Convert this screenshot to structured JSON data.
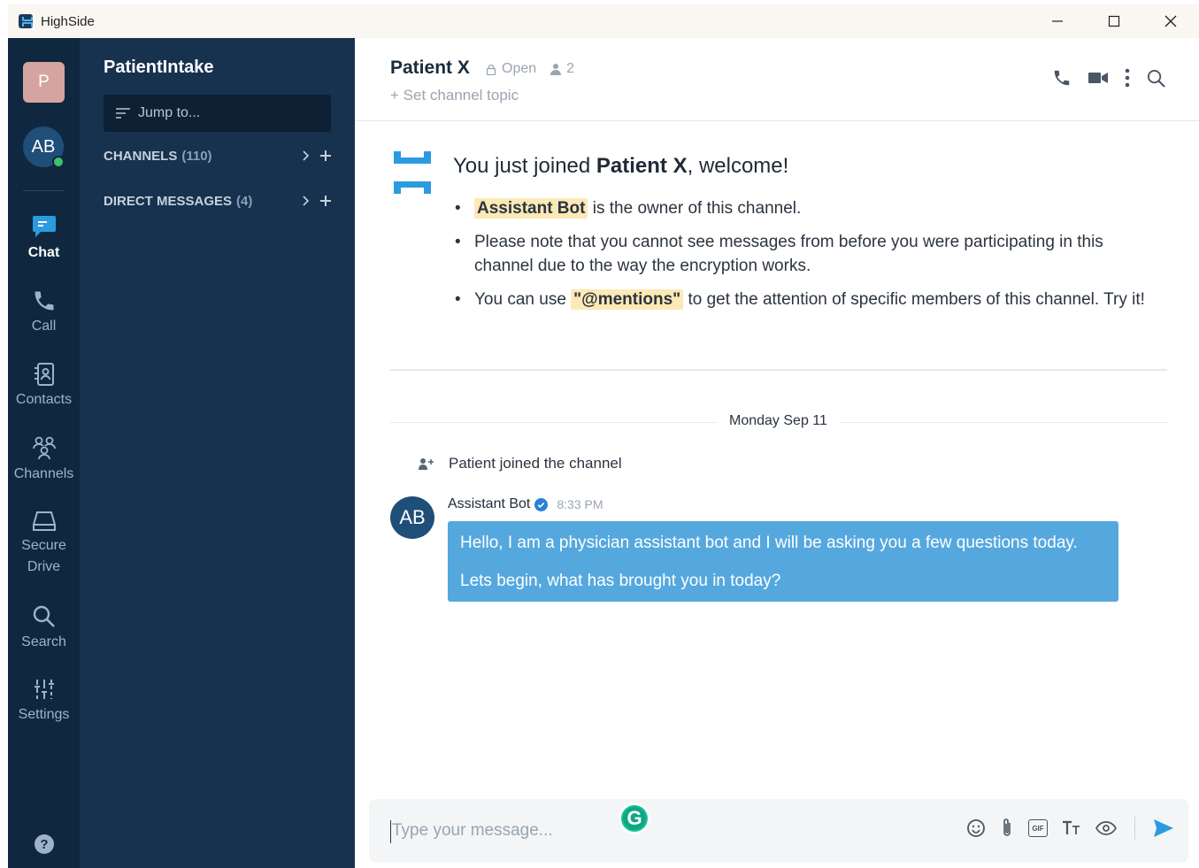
{
  "window": {
    "title": "HighSide"
  },
  "rail": {
    "workspace_initial": "P",
    "user_initials": "AB",
    "items": [
      {
        "label": "Chat",
        "icon": "chat-icon"
      },
      {
        "label": "Call",
        "icon": "phone-icon"
      },
      {
        "label": "Contacts",
        "icon": "contacts-icon"
      },
      {
        "label": "Channels",
        "icon": "channels-icon"
      },
      {
        "label": "Secure",
        "label2": "Drive",
        "icon": "drive-icon"
      },
      {
        "label": "Search",
        "icon": "search-icon"
      },
      {
        "label": "Settings",
        "icon": "settings-icon"
      }
    ],
    "help": "?"
  },
  "sidebar": {
    "workspace_name": "PatientIntake",
    "jump_placeholder": "Jump to...",
    "channels_label": "CHANNELS",
    "channels_count": "(110)",
    "dm_label": "DIRECT MESSAGES",
    "dm_count": "(4)"
  },
  "channel": {
    "name": "Patient X",
    "status": "Open",
    "members": "2",
    "topic_prompt": "+ Set channel topic"
  },
  "welcome": {
    "prefix": "You just joined ",
    "channel": "Patient X",
    "suffix": ", welcome!",
    "b1_owner": "Assistant Bot",
    "b1_text": " is the owner of this channel.",
    "b2_text": "Please note that you cannot see messages from before you were participating in this channel due to the way the encryption works.",
    "b3_pre": "You can use ",
    "b3_mentions": "\"@mentions\"",
    "b3_post": " to get the attention of specific members of this channel. Try it!"
  },
  "timeline": {
    "date": "Monday Sep 11",
    "system_message": "Patient joined the channel",
    "message": {
      "avatar": "AB",
      "author": "Assistant Bot",
      "time": "8:33 PM",
      "line1": "Hello, I am a physician assistant bot and I will be asking you a few questions today.",
      "line2": "Lets begin, what has brought you in today?"
    }
  },
  "composer": {
    "placeholder": "Type your message...",
    "gif": "GIF"
  },
  "colors": {
    "rail_bg": "#0f2840",
    "sidebar_bg": "#17324f",
    "bubble_bg": "#55a8de",
    "highlight": "#fde9b6",
    "accent": "#2b9be0"
  }
}
